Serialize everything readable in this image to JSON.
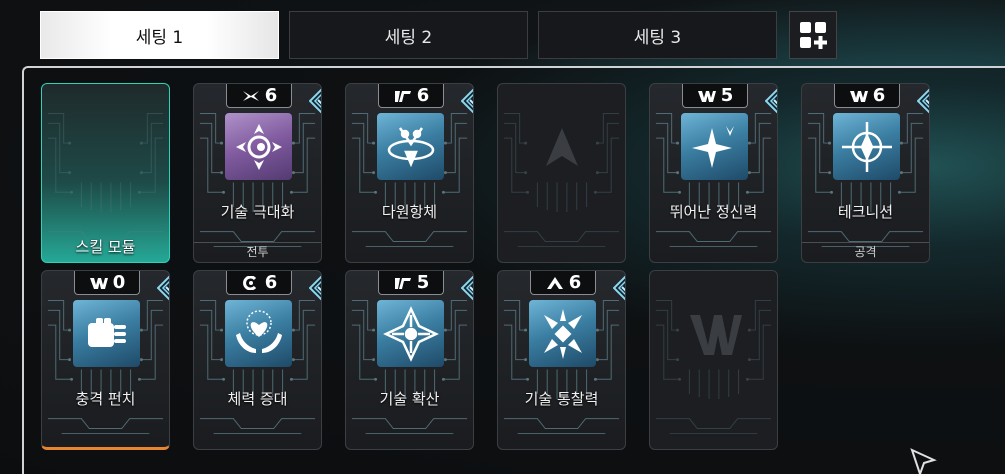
{
  "tabs": [
    {
      "label": "세팅 1",
      "active": true
    },
    {
      "label": "세팅 2",
      "active": false
    },
    {
      "label": "세팅 3",
      "active": false
    }
  ],
  "add_preset_icon": "grid-plus-icon",
  "slots": [
    {
      "type": "empty-selected",
      "name": "스킬 모듈"
    },
    {
      "type": "skill",
      "level": "6",
      "level_icon": "star-burst",
      "name": "기술 극대화",
      "category": "전투",
      "icon": "eye-spiral-icon",
      "color": "purple"
    },
    {
      "type": "skill",
      "level": "6",
      "level_icon": "slash-marks",
      "name": "다원항체",
      "icon": "tri-shield-icon",
      "color": "blue"
    },
    {
      "type": "locked",
      "icon": "chevron-arrow-icon"
    },
    {
      "type": "skill",
      "level": "5",
      "level_icon": "mw-mark",
      "name": "뛰어난 정신력",
      "icon": "sparkle-star-icon",
      "color": "blue"
    },
    {
      "type": "skill",
      "level": "6",
      "level_icon": "mw-mark",
      "name": "테크니션",
      "category": "공격",
      "icon": "compass-icon",
      "color": "blue"
    },
    {
      "type": "skill",
      "level": "0",
      "level_icon": "mw-mark",
      "name": "충격 펀치",
      "icon": "fist-icon",
      "color": "blue"
    },
    {
      "type": "skill",
      "level": "6",
      "level_icon": "c-mark",
      "name": "체력 증대",
      "icon": "heart-hands-icon",
      "color": "blue"
    },
    {
      "type": "skill",
      "level": "5",
      "level_icon": "slash-marks",
      "name": "기술 확산",
      "icon": "diamond-cross-icon",
      "color": "blue"
    },
    {
      "type": "skill",
      "level": "6",
      "level_icon": "caret-mark",
      "name": "기술 통찰력",
      "icon": "x-burst-icon",
      "color": "blue"
    },
    {
      "type": "locked",
      "icon": "mw-mark-icon"
    }
  ]
}
